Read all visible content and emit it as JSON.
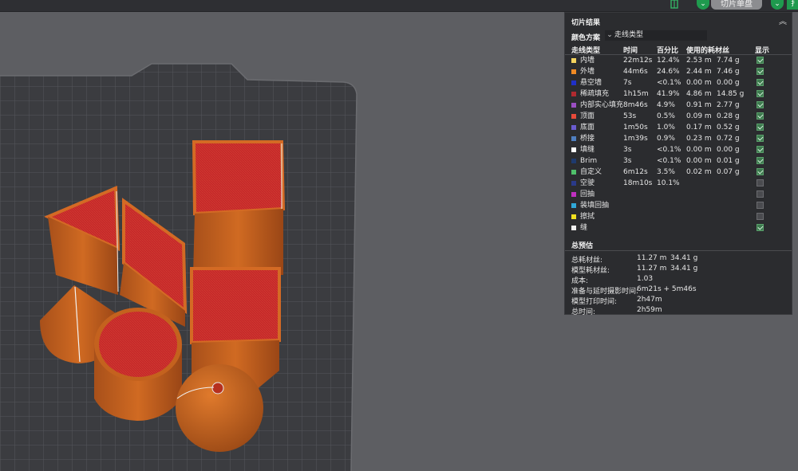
{
  "toolbar": {
    "slice_button_label": "切片单盘",
    "dropdown_glyph": "⌄",
    "next_button_glyph": "扌"
  },
  "panel": {
    "title": "切片结果",
    "collapse_glyph": "︽",
    "color_scheme_label": "颜色方案",
    "color_scheme_value": "走线类型",
    "columns": {
      "type": "走线类型",
      "time": "时间",
      "percent": "百分比",
      "filament": "使用的耗材丝",
      "display": "显示"
    },
    "rows": [
      {
        "label": "内墙",
        "color": "#f4d35e",
        "time": "22m12s",
        "percent": "12.4%",
        "length": "2.53 m",
        "weight": "7.74 g",
        "visible": true
      },
      {
        "label": "外墙",
        "color": "#f08a24",
        "time": "44m6s",
        "percent": "24.6%",
        "length": "2.44 m",
        "weight": "7.46 g",
        "visible": true
      },
      {
        "label": "悬空墙",
        "color": "#2030c8",
        "time": "7s",
        "percent": "<0.1%",
        "length": "0.00 m",
        "weight": "0.00 g",
        "visible": true
      },
      {
        "label": "稀疏填充",
        "color": "#b02a30",
        "time": "1h15m",
        "percent": "41.9%",
        "length": "4.86 m",
        "weight": "14.85 g",
        "visible": true
      },
      {
        "label": "内部实心填充",
        "color": "#9b4fc4",
        "time": "8m46s",
        "percent": "4.9%",
        "length": "0.91 m",
        "weight": "2.77 g",
        "visible": true
      },
      {
        "label": "顶面",
        "color": "#e84a3a",
        "time": "53s",
        "percent": "0.5%",
        "length": "0.09 m",
        "weight": "0.28 g",
        "visible": true
      },
      {
        "label": "底面",
        "color": "#6a5cd0",
        "time": "1m50s",
        "percent": "1.0%",
        "length": "0.17 m",
        "weight": "0.52 g",
        "visible": true
      },
      {
        "label": "桥接",
        "color": "#4f7fc0",
        "time": "1m39s",
        "percent": "0.9%",
        "length": "0.23 m",
        "weight": "0.72 g",
        "visible": true
      },
      {
        "label": "填缝",
        "color": "#ffffff",
        "time": "3s",
        "percent": "<0.1%",
        "length": "0.00 m",
        "weight": "0.00 g",
        "visible": true
      },
      {
        "label": "Brim",
        "color": "#1e3a6e",
        "time": "3s",
        "percent": "<0.1%",
        "length": "0.00 m",
        "weight": "0.01 g",
        "visible": true
      },
      {
        "label": "自定义",
        "color": "#4fc06a",
        "time": "6m12s",
        "percent": "3.5%",
        "length": "0.02 m",
        "weight": "0.07 g",
        "visible": true
      },
      {
        "label": "空驶",
        "color": "#2a3a8a",
        "time": "18m10s",
        "percent": "10.1%",
        "length": "",
        "weight": "",
        "visible": false
      },
      {
        "label": "回抽",
        "color": "#c030c0",
        "time": "",
        "percent": "",
        "length": "",
        "weight": "",
        "visible": false
      },
      {
        "label": "装填回抽",
        "color": "#30a8d8",
        "time": "",
        "percent": "",
        "length": "",
        "weight": "",
        "visible": false
      },
      {
        "label": "擦拭",
        "color": "#f0e020",
        "time": "",
        "percent": "",
        "length": "",
        "weight": "",
        "visible": false
      },
      {
        "label": "缝",
        "color": "#f0f0f0",
        "time": "",
        "percent": "",
        "length": "",
        "weight": "",
        "visible": true
      }
    ],
    "summary": {
      "title": "总预估",
      "items": [
        {
          "label": "总耗材丝:",
          "value": "11.27 m",
          "value2": "34.41 g"
        },
        {
          "label": "模型耗材丝:",
          "value": "11.27 m",
          "value2": "34.41 g"
        },
        {
          "label": "成本:",
          "value": "1.03",
          "value2": ""
        },
        {
          "label": "准备与延时摄影时间:",
          "value": "6m21s + 5m46s",
          "value2": ""
        },
        {
          "label": "模型打印时间:",
          "value": "2h47m",
          "value2": ""
        },
        {
          "label": "总时间:",
          "value": "2h59m",
          "value2": ""
        }
      ]
    }
  },
  "colors": {
    "accent_green": "#1f9a4e",
    "plate": "#3d3e42",
    "model_orange": "#c8621c",
    "model_top_red": "#c42a2a"
  }
}
